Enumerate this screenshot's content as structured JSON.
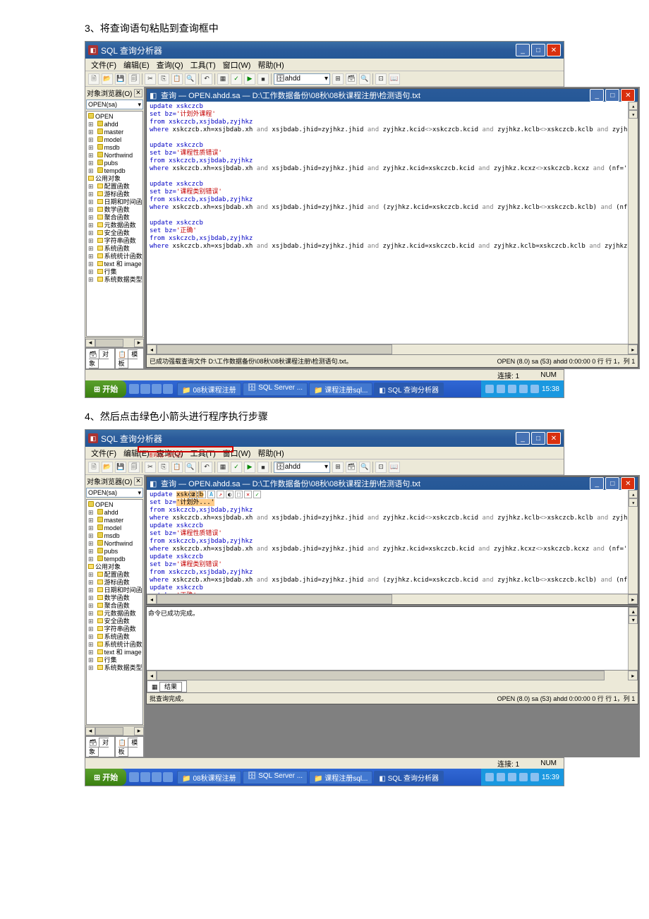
{
  "steps": {
    "s3": "3、将查询语句粘贴到查询框中",
    "s4": "4、然后点击绿色小箭头进行程序执行步骤"
  },
  "app": {
    "title": "SQL 查询分析器",
    "menu": {
      "file": "文件(F)",
      "edit": "编辑(E)",
      "query": "查询(Q)",
      "tools": "工具(T)",
      "window": "窗口(W)",
      "help": "帮助(H)"
    },
    "toolbar": {
      "db_combo": "ahdd"
    },
    "sidebar": {
      "title": "对象浏览器(O)",
      "server_combo": "OPEN(sa)",
      "tree_root": "OPEN",
      "databases": [
        "ahdd",
        "master",
        "model",
        "msdb",
        "Northwind",
        "pubs",
        "tempdb"
      ],
      "common_obj": "公用对象",
      "folders": [
        "配置函数",
        "游标函数",
        "日期和时间函数",
        "数学函数",
        "聚合函数",
        "元数据函数",
        "安全函数",
        "字符串函数",
        "系统函数",
        "系统统计函数",
        "text 和 image 函数",
        "行集",
        "系统数据类型"
      ],
      "tabs": {
        "obj": "对象",
        "tpl": "模板"
      }
    },
    "inner": {
      "title_prefix": "查询 — OPEN.ahdd.sa — ",
      "path": "D:\\工作数据备份\\08秋\\08秋课程注册\\检测语句.txt"
    },
    "sql": {
      "u": "update xskczcb",
      "f": "from xskczcb,xsjbdab,zyjhkz",
      "set1": "set bz='计划外课程'",
      "w1": "where xskczcb.xh=xsjbdab.xh and xsjbdab.jhid=zyjhkz.jhid and zyjhkz.kcid<>xskczcb.kcid and zyjhkz.kclb<>xskczcb.kclb and zyjhkz",
      "set2": "set bz='课程性质错误'",
      "w2": "where xskczcb.xh=xsjbdab.xh and xsjbdab.jhid=zyjhkz.jhid and zyjhkz.kcid=xskczcb.kcid  and zyjhkz.kcxz<>xskczcb.kcxz and (nf='2",
      "set3": "set bz='课程类别错误'",
      "w3": "where xskczcb.xh=xsjbdab.xh and xsjbdab.jhid=zyjhkz.jhid and (zyjhkz.kcid=xskczcb.kcid   and zyjhkz.kclb<>xskczcb.kclb) and (nf",
      "set4": "set bz='正确'",
      "w4": "where xskczcb.xh=xsjbdab.xh and xsjbdab.jhid=zyjhkz.jhid and zyjhkz.kcid=xskczcb.kcid and zyjhkz.kclb=xskczcb.kclb and zyjhkz.k"
    },
    "status1": {
      "left": "已成功强载查询文件 D:\\工作数据备份\\08秋\\08秋课程注册\\检测语句.txt。",
      "right": "OPEN (8.0)  sa (53)  ahdd   0:00:00   0 行  行 1，列 1"
    },
    "status2": {
      "msg": "命令已成功完成。",
      "tab": "结果",
      "left": "批查询完成。",
      "right": "OPEN (8.0)  sa (53)  ahdd   0:00:00   0 行  行 1，列 1"
    },
    "appstatus": {
      "conn": "连接: 1",
      "num": "NUM"
    },
    "taskbar": {
      "start": "开始",
      "tasks": [
        "08秋课程注册",
        "SQL Server ...",
        "课程注册sql...",
        "SQL 查询分析器"
      ],
      "time": "15:38",
      "time2": "15:39"
    },
    "annot": {
      "label": "查询(Q)—执行(E)"
    }
  }
}
